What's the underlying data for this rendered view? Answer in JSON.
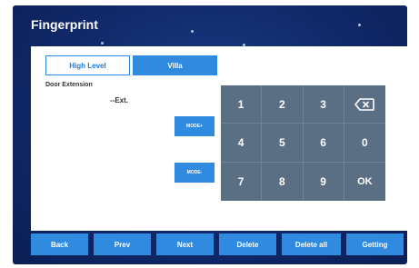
{
  "title": "Fingerprint",
  "tabs": [
    {
      "label": "High Level",
      "selected": false
    },
    {
      "label": "Villa",
      "selected": true
    }
  ],
  "door_extension_label": "Door Extension",
  "extension_value": "--Ext.",
  "mode_buttons": {
    "plus": "MODE+",
    "minus": "MODE-"
  },
  "keypad": {
    "keys": [
      "1",
      "2",
      "3",
      "",
      "4",
      "5",
      "6",
      "0",
      "7",
      "8",
      "9",
      "OK"
    ],
    "backspace_icon": "backspace-icon"
  },
  "bottom_bar": {
    "back": "Back",
    "prev": "Prev",
    "next": "Next",
    "delete": "Delete",
    "delete_all": "Delete all",
    "getting": "Getting"
  },
  "colors": {
    "accent": "#2f8ae0",
    "background": "#10296a",
    "keypad": "#5a6e84",
    "panel": "#ffffff"
  }
}
